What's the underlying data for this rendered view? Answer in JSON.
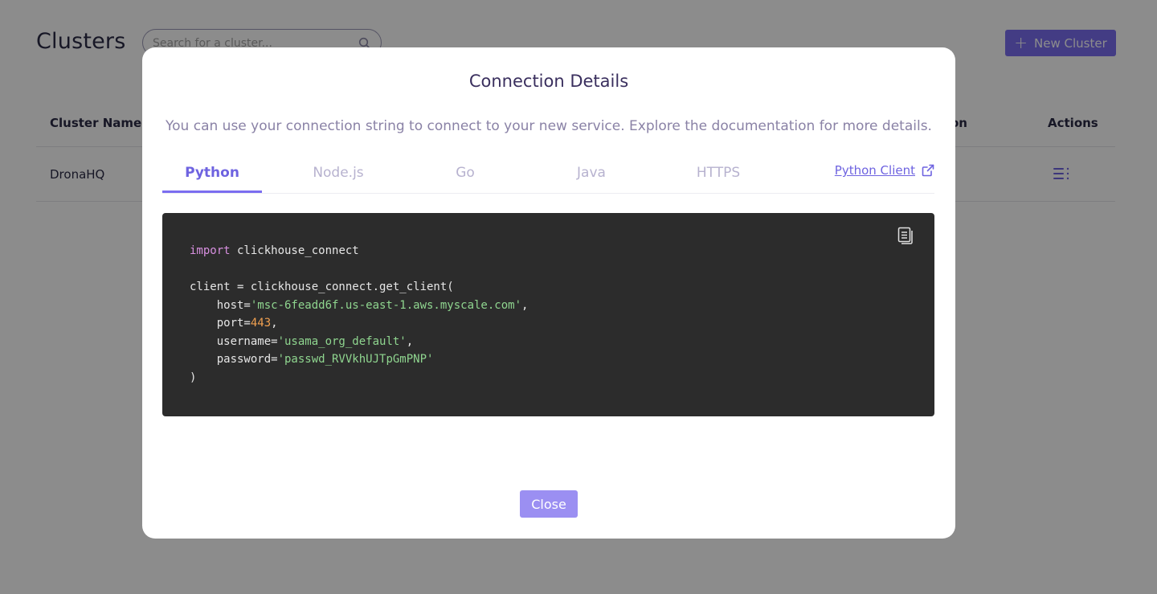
{
  "background": {
    "page_title": "Clusters",
    "search": {
      "placeholder": "Search for a cluster..."
    },
    "new_cluster_button": {
      "label": "New Cluster"
    },
    "table": {
      "headers": [
        "Cluster Name",
        "on",
        "Actions"
      ],
      "rows": [
        {
          "name": "DronaHQ"
        }
      ]
    }
  },
  "modal": {
    "title": "Connection Details",
    "subtitle": "You can use your connection string to connect to your new service. Explore the documentation for more details.",
    "tabs": [
      {
        "label": "Python",
        "active": true
      },
      {
        "label": "Node.js",
        "active": false
      },
      {
        "label": "Go",
        "active": false
      },
      {
        "label": "Java",
        "active": false
      },
      {
        "label": "HTTPS",
        "active": false
      }
    ],
    "client_link": "Python Client",
    "code": {
      "import_kw": "import",
      "import_module": " clickhouse_connect",
      "client_line": "client = clickhouse_connect.get_client(",
      "host_key": "    host=",
      "host_val": "'msc-6feadd6f.us-east-1.aws.myscale.com'",
      "port_key": "    port=",
      "port_val": "443",
      "username_key": "    username=",
      "username_val": "'usama_org_default'",
      "password_key": "    password=",
      "password_val": "'passwd_RVVkhUJTpGmPNP'",
      "close_paren": ")",
      "comma": ","
    },
    "close_button": "Close"
  },
  "colors": {
    "accent": "#7b6df0",
    "title": "#3a2f5e",
    "code_bg": "#2c2c2c",
    "overlay": "rgba(0,0,0,0.45)"
  }
}
